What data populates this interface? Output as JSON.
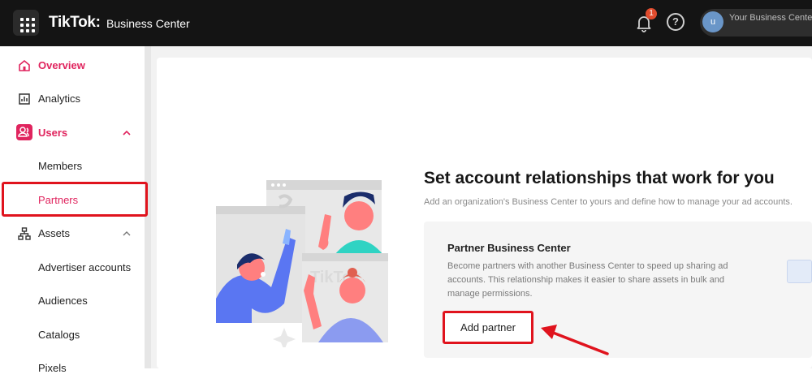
{
  "topbar": {
    "logo": "TikTok:",
    "logo_sub": "Business Center",
    "notification_count": "1",
    "help": "?",
    "avatar_initial": "u",
    "account_name": "Your Business Center"
  },
  "sidebar": {
    "items": [
      {
        "label": "Overview",
        "icon": "home-icon"
      },
      {
        "label": "Analytics",
        "icon": "chart-icon"
      },
      {
        "label": "Users",
        "icon": "users-icon"
      },
      {
        "label": "Members"
      },
      {
        "label": "Partners"
      },
      {
        "label": "Assets",
        "icon": "assets-icon"
      },
      {
        "label": "Advertiser accounts"
      },
      {
        "label": "Audiences"
      },
      {
        "label": "Catalogs"
      },
      {
        "label": "Pixels"
      }
    ]
  },
  "main": {
    "title": "Set account relationships that work for you",
    "subtitle": "Add an organization's Business Center to yours and define how to manage your ad accounts.",
    "partner_card": {
      "title": "Partner Business Center",
      "description": "Become partners with another Business Center to speed up sharing ad accounts. This relationship makes it easier to share assets in bulk and manage permissions.",
      "button": "Add partner"
    },
    "illustration_text": "TikTok"
  },
  "colors": {
    "accent": "#e0245e",
    "highlight": "#e0131d",
    "topbar": "#141414"
  }
}
